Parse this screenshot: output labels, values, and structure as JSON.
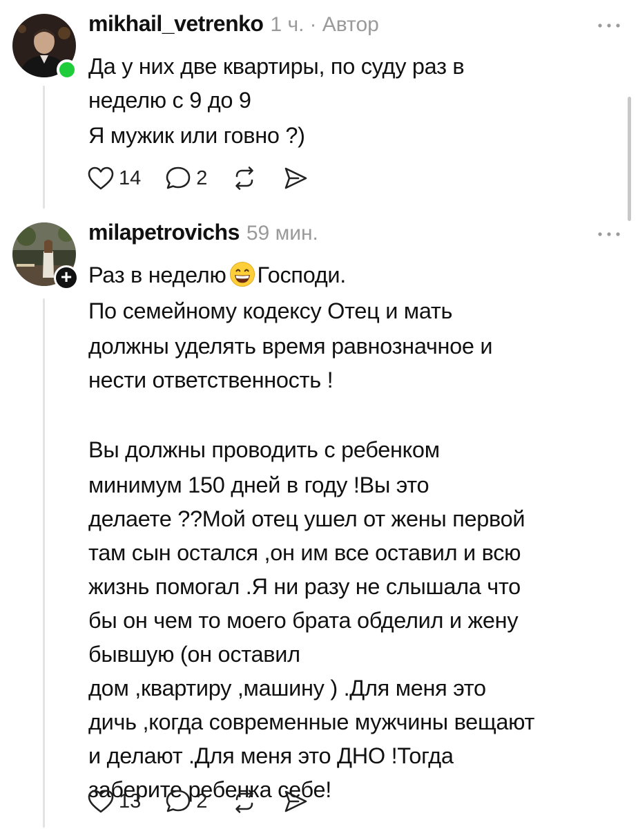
{
  "posts": [
    {
      "username": "mikhail_vetrenko",
      "time": "1 ч.",
      "author_tag": "· Автор",
      "lines": [
        "Да у них две квартиры, по суду раз в",
        "неделю с 9 до 9",
        "Я мужик или говно ?)"
      ],
      "likes": "14",
      "replies": "2"
    },
    {
      "username": "milapetrovichs",
      "time": "59 мин.",
      "first_line_before": "Раз в неделю",
      "first_line_after": "Господи.",
      "emoji": "grinning-face-emoji",
      "paragraph1": [
        "По семейному кодексу Отец и мать",
        "должны уделять время равнозначное и",
        "нести ответственность !"
      ],
      "paragraph2": [
        "Вы должны проводить с ребенком",
        "минимум 150 дней в году !Вы это",
        "делаете ??Мой отец ушел от жены первой",
        "там сын остался ,он им все оставил и всю",
        "жизнь помогал .Я ни разу не слышала что",
        "бы он чем то моего брата обделил и жену",
        "бывшую (он оставил",
        "дом ,квартиру ,машину ) .Для меня это",
        "дичь ,когда современные мужчины вещают",
        "и делают .Для меня это ДНО !Тогда",
        "заберите ребенка себе!"
      ],
      "likes": "13",
      "replies": "2"
    }
  ],
  "icons": {
    "like": "heart-icon",
    "reply": "comment-bubble-icon",
    "repost": "repost-icon",
    "share": "send-icon",
    "more": "more-dots-icon"
  },
  "colors": {
    "online": "#1fcc3a",
    "meta_text": "#9a9a9a",
    "text": "#111111"
  }
}
